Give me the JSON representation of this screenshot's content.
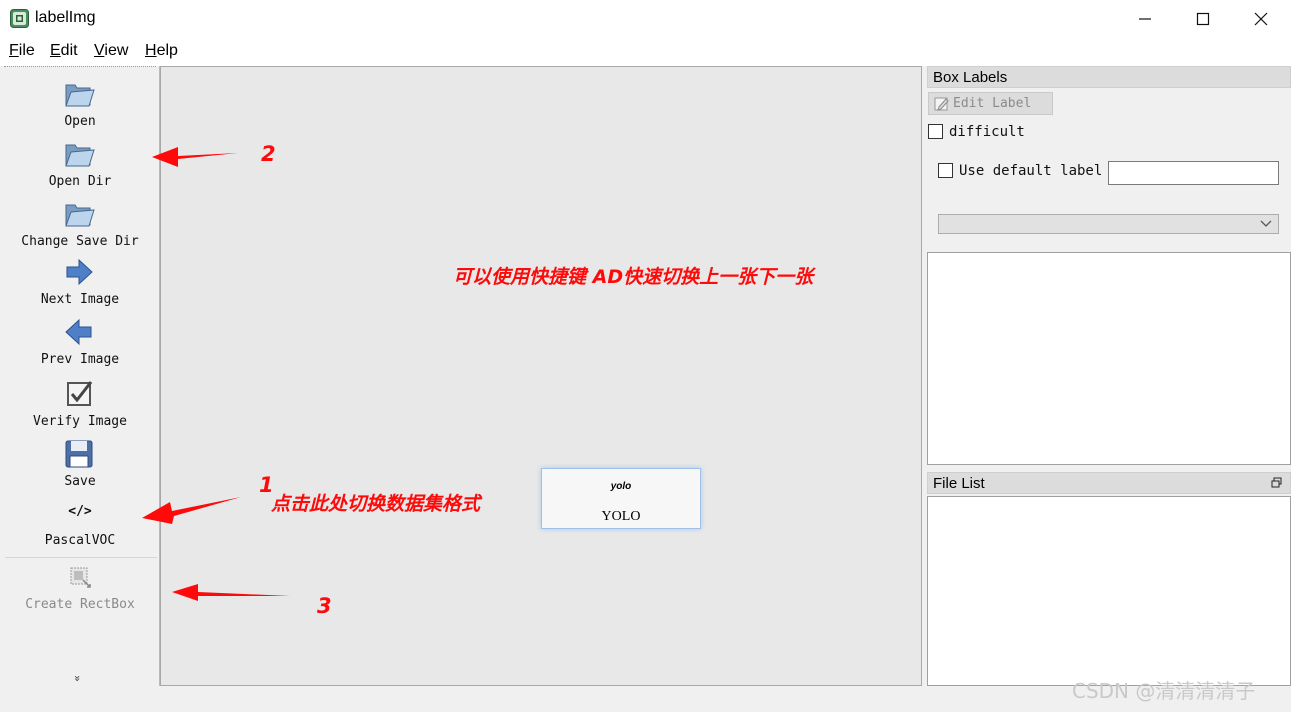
{
  "window": {
    "title": "labelImg",
    "minimize_icon": "minimize-icon",
    "maximize_icon": "maximize-icon",
    "close_icon": "close-icon"
  },
  "menu": [
    {
      "mnemonic": "F",
      "rest": "ile"
    },
    {
      "mnemonic": "E",
      "rest": "dit"
    },
    {
      "mnemonic": "V",
      "rest": "iew"
    },
    {
      "mnemonic": "H",
      "rest": "elp"
    }
  ],
  "toolbar": {
    "open": {
      "label": "Open",
      "icon": "folder-open-icon"
    },
    "open_dir": {
      "label": "Open Dir",
      "icon": "folder-open-icon"
    },
    "change_save_dir": {
      "label": "Change Save Dir",
      "icon": "folder-open-icon"
    },
    "next_image": {
      "label": "Next Image",
      "icon": "arrow-right-icon"
    },
    "prev_image": {
      "label": "Prev Image",
      "icon": "arrow-left-icon"
    },
    "verify_image": {
      "label": "Verify Image",
      "icon": "checkbox-verify-icon"
    },
    "save": {
      "label": "Save",
      "icon": "floppy-disk-icon"
    },
    "format": {
      "label": "PascalVOC",
      "icon_text": "</>"
    },
    "create_rectbox": {
      "label": "Create RectBox",
      "icon": "rectbox-icon"
    },
    "expand_glyph": "»"
  },
  "annotations": {
    "shortcut_hint": "可以使用快捷键 AD快速切换上一张下一张",
    "num1": "1",
    "hint1": "点击此处切换数据集格式",
    "num2": "2",
    "num3": "3"
  },
  "format_popup": {
    "top_label": "yolo",
    "bottom_label": "YOLO"
  },
  "box_labels": {
    "title": "Box Labels",
    "edit_label": "Edit Label",
    "difficult": "difficult",
    "use_default_label": "Use default label",
    "default_label_value": ""
  },
  "file_list": {
    "title": "File List"
  },
  "watermark": "CSDN @清清清清子",
  "colors": {
    "annotation_red": "#ff0a0a",
    "canvas_bg": "#e8e8e8",
    "popup_border": "#9fc0e8"
  }
}
